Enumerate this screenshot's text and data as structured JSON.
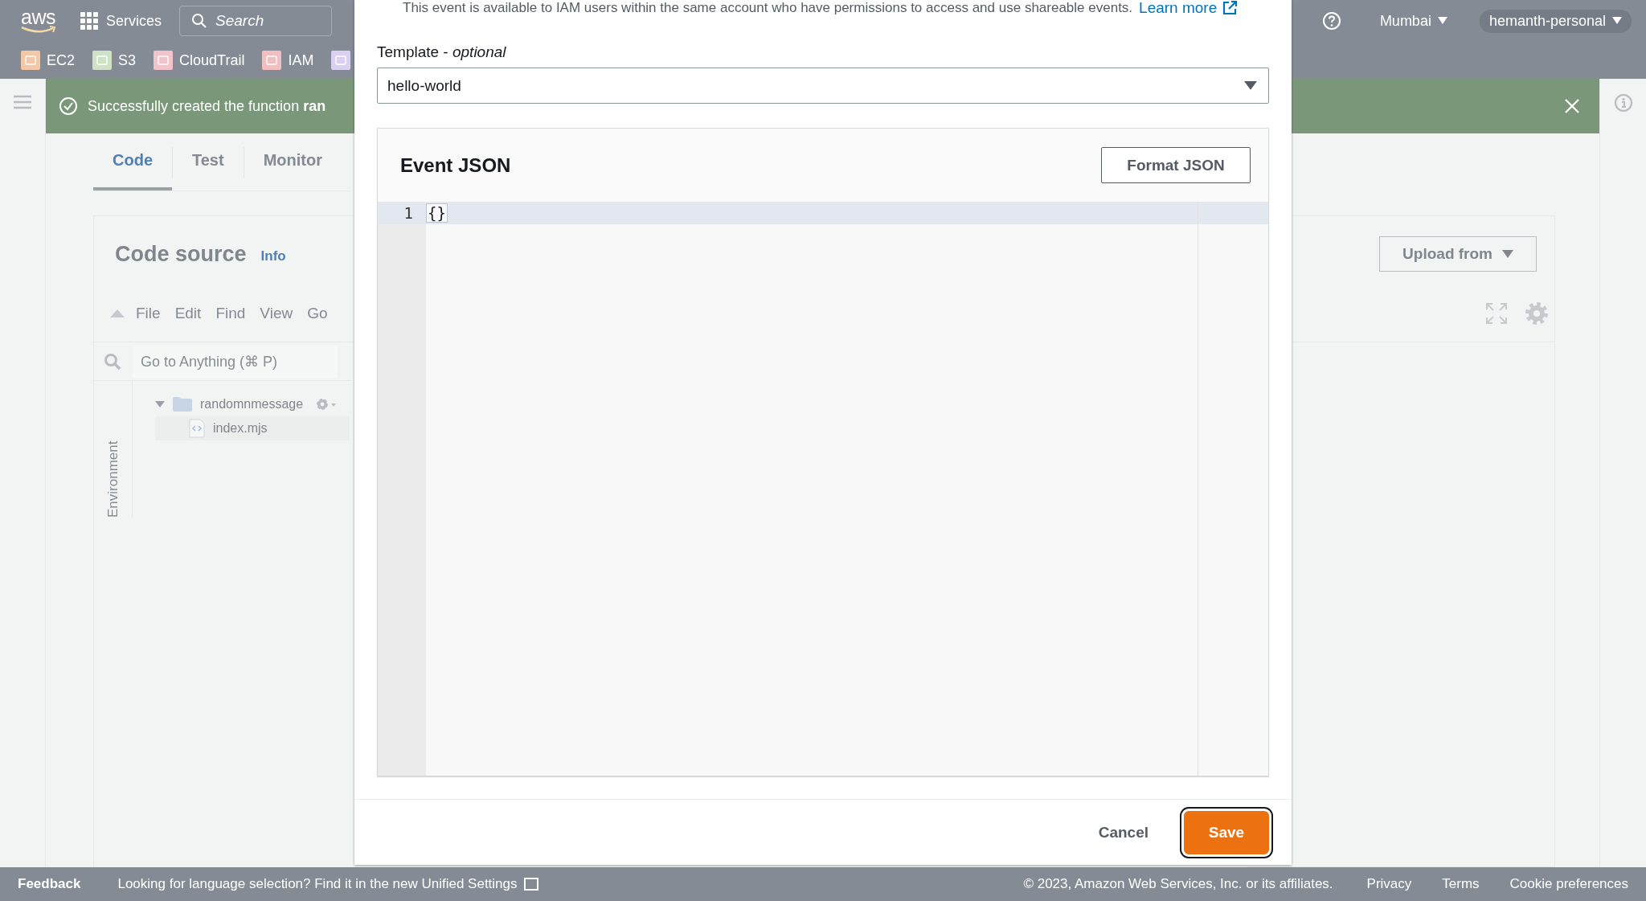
{
  "nav": {
    "logo": "aws",
    "services": "Services",
    "search_placeholder": "Search",
    "region": "Mumbai",
    "account": "hemanth-personal"
  },
  "favorites": [
    {
      "label": "EC2",
      "color": "#f4c7a6"
    },
    {
      "label": "S3",
      "color": "#cfe2c6"
    },
    {
      "label": "CloudTrail",
      "color": "#f3c3ca"
    },
    {
      "label": "IAM",
      "color": "#f1bfbf"
    },
    {
      "color": "#d9d0f2"
    }
  ],
  "flash": {
    "message": "Successfully created the function **ran**"
  },
  "tabs": [
    {
      "label": "Code",
      "selected": true
    },
    {
      "label": "Test",
      "selected": false
    },
    {
      "label": "Monitor",
      "selected": false
    }
  ],
  "code_source": {
    "title": "Code source",
    "info": "Info",
    "upload_button": "Upload from",
    "menu": [
      "File",
      "Edit",
      "Find",
      "View",
      "Go"
    ],
    "goto_placeholder": "Go to Anything (⌘ P)",
    "environment_label": "Environment",
    "tree": [
      {
        "name": "randomnmessage",
        "kind": "folder",
        "expanded": true,
        "children": [
          {
            "name": "index.mjs",
            "kind": "file"
          }
        ]
      }
    ]
  },
  "modal": {
    "description": "This event is available to IAM users within the same account who have permissions to access and use shareable events.",
    "learn_more": "Learn more",
    "template_label": "Template - *optional*",
    "template_value": "hello-world",
    "event_json": {
      "title": "Event JSON",
      "format_button": "Format JSON",
      "lines": [
        {
          "number": "1",
          "text": "{}",
          "active": true
        }
      ]
    },
    "cancel": "Cancel",
    "save": "Save"
  },
  "footer": {
    "feedback": "Feedback",
    "language_notice": "Looking for language selection? Find it in the new Unified Settings",
    "copyright": "© 2023, Amazon Web Services, Inc. or its affiliates.",
    "links": [
      "Privacy",
      "Terms",
      "Cookie preferences"
    ]
  }
}
